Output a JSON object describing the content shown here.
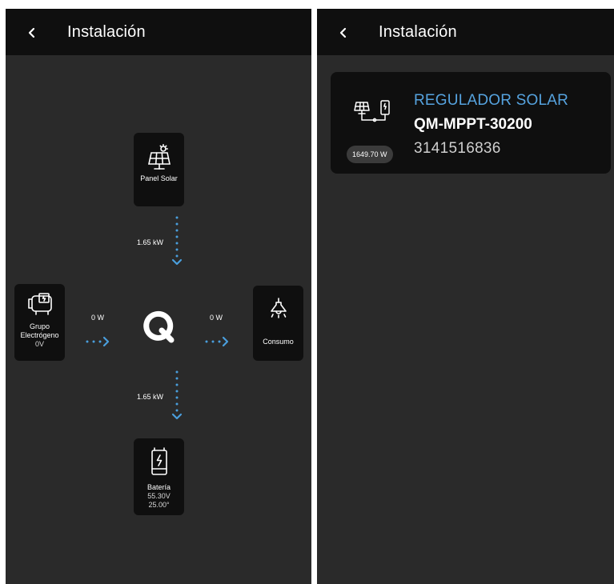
{
  "left_screen": {
    "app_bar": {
      "title": "Instalación",
      "back_icon": "chevron-left-icon"
    },
    "nodes": {
      "solar_panel": {
        "label": "Panel Solar",
        "icon": "solar-panel-icon"
      },
      "generator": {
        "label_line1": "Grupo",
        "label_line2": "Electrógeno",
        "voltage": "0V",
        "icon": "generator-icon"
      },
      "consumption": {
        "label": "Consumo",
        "icon": "lamp-icon"
      },
      "battery": {
        "label": "Batería",
        "voltage": "55.30V",
        "temperature": "25.00°",
        "icon": "battery-icon"
      }
    },
    "flows": {
      "solar_to_hub": "1.65 kW",
      "generator_to_hub": "0 W",
      "hub_to_consumption": "0 W",
      "hub_to_battery": "1.65 kW"
    },
    "hub_logo": "q-logo"
  },
  "right_screen": {
    "app_bar": {
      "title": "Instalación",
      "back_icon": "chevron-left-icon"
    },
    "device_card": {
      "type": "REGULADOR SOLAR",
      "model": "QM-MPPT-30200",
      "serial": "3141516836",
      "power": "1649.70 W",
      "icon": "solar-regulator-icon"
    }
  },
  "colors": {
    "background": "#2a2a2a",
    "surface": "#0f0f0f",
    "accent_blue": "#56a3df",
    "text_primary": "#ffffff"
  }
}
